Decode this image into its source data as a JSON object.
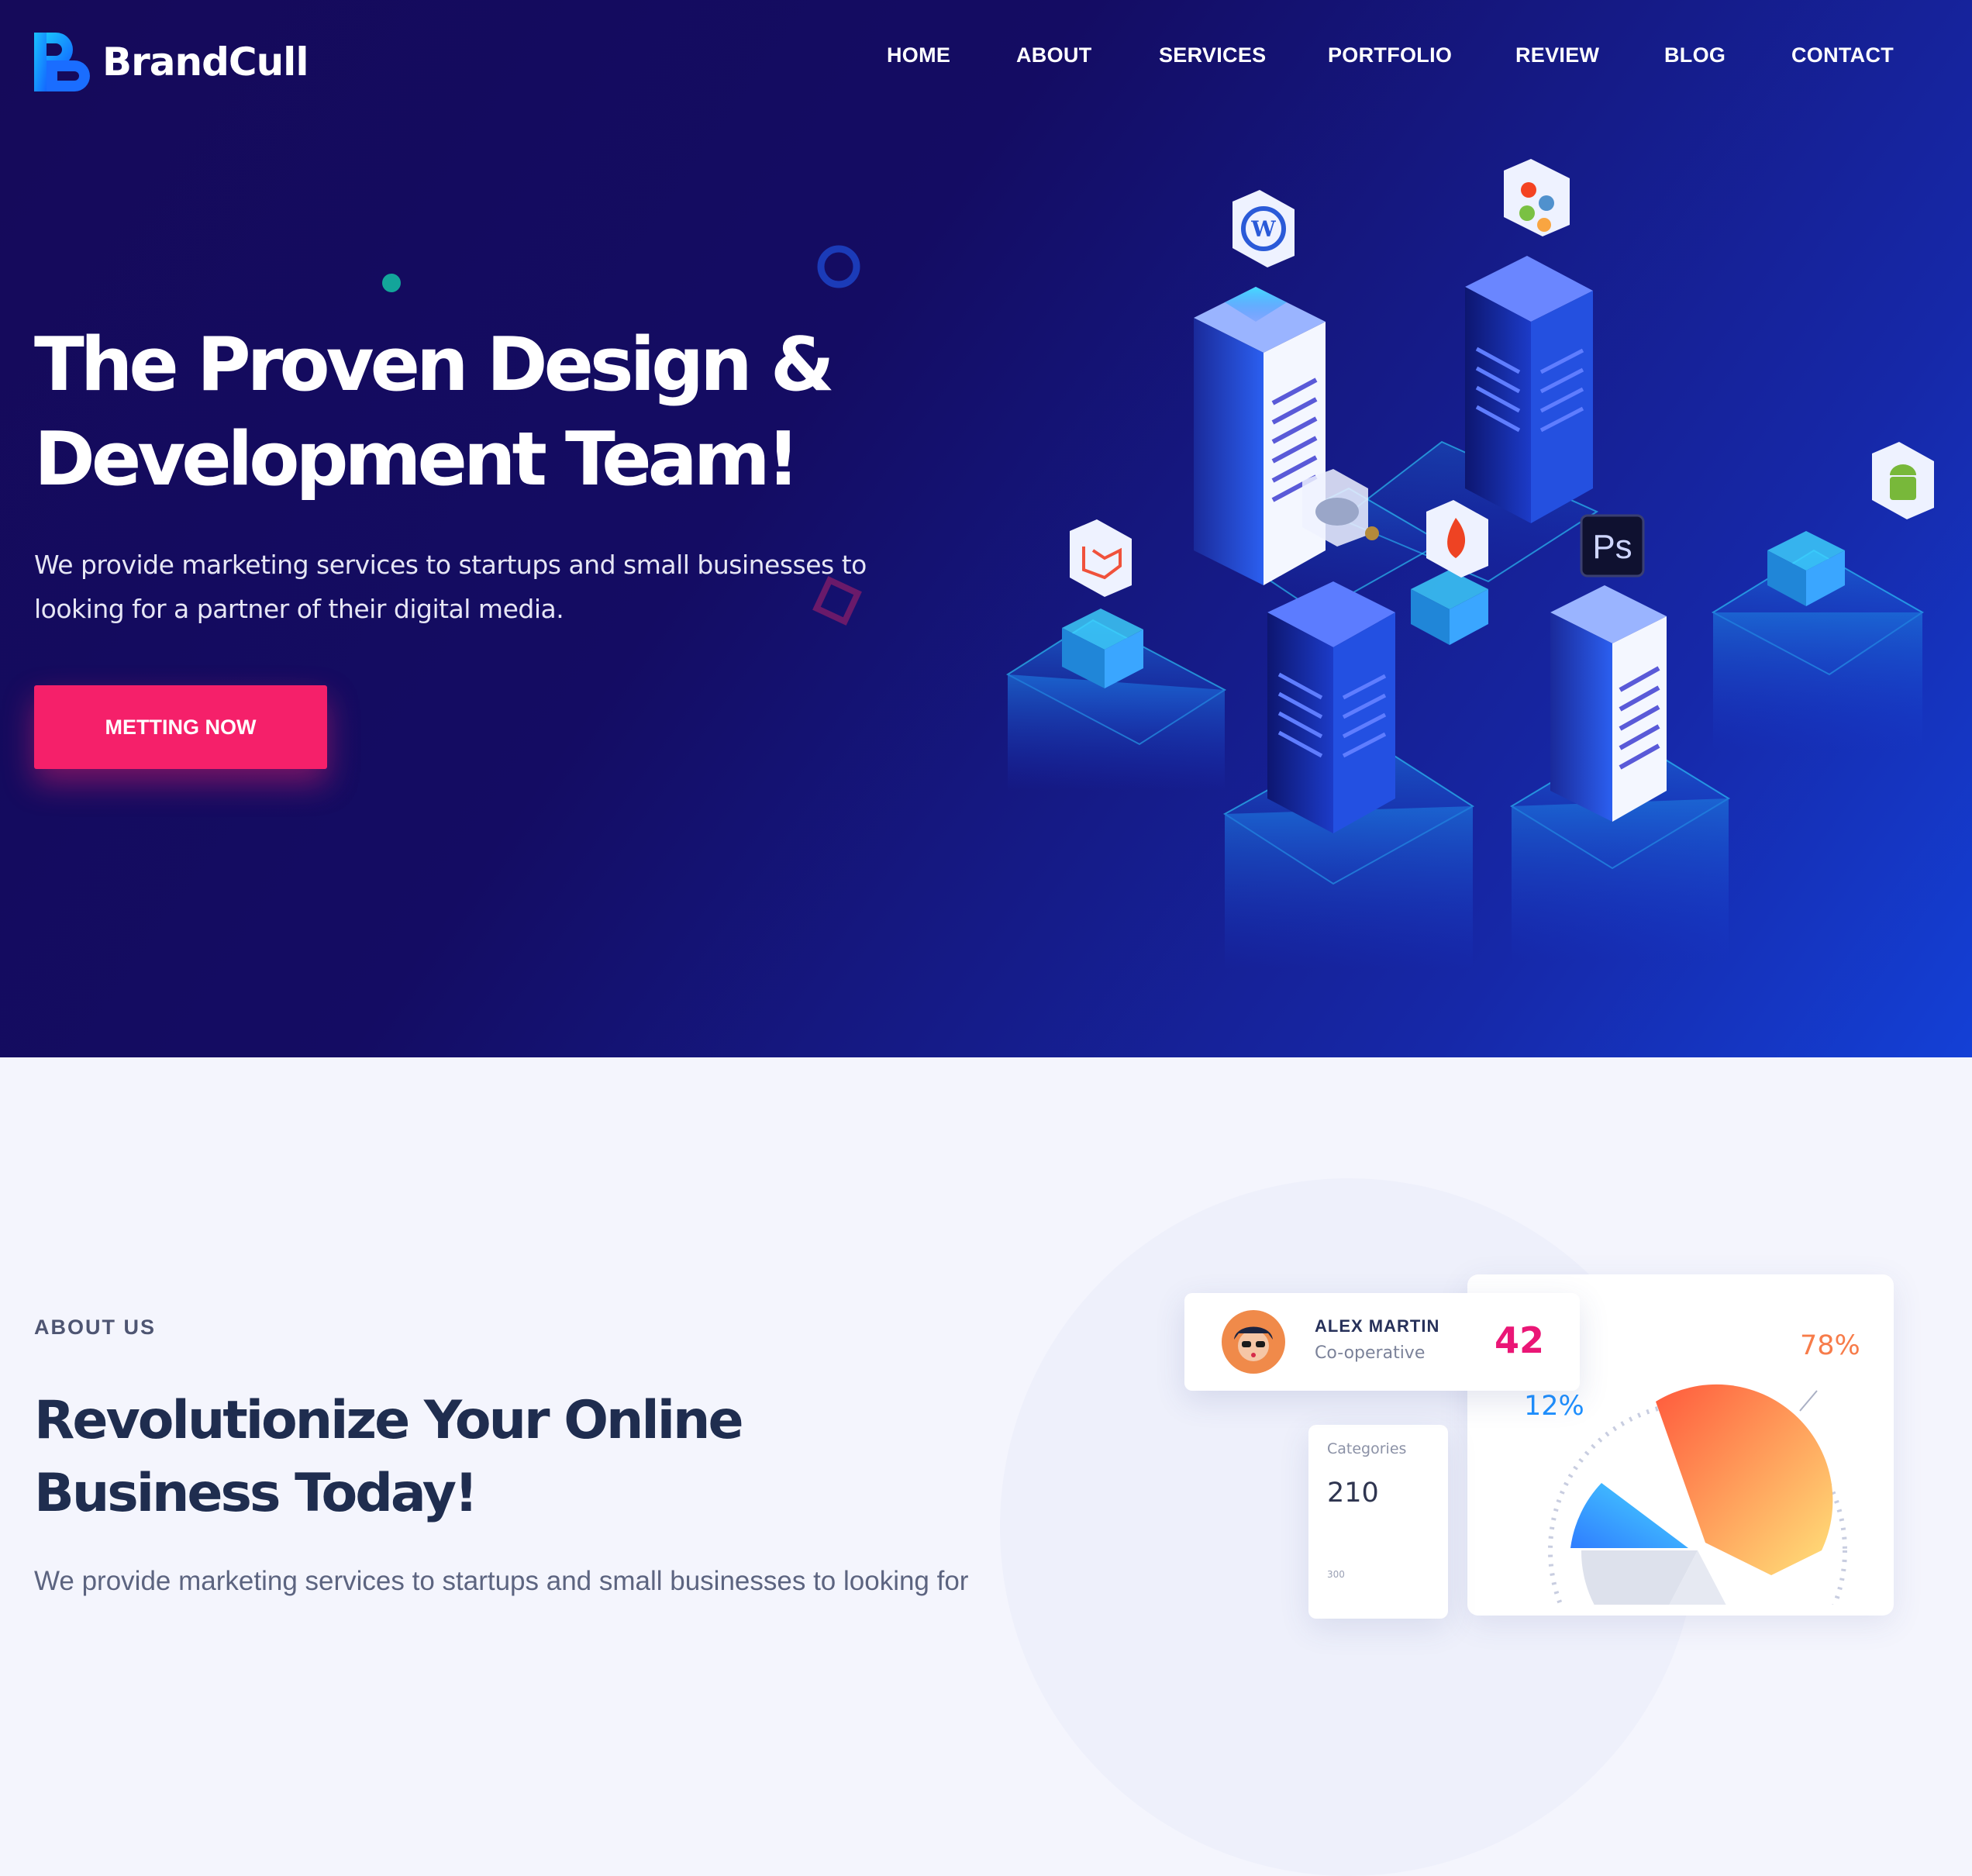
{
  "brand": {
    "name": "BrandCull"
  },
  "nav": {
    "items": [
      {
        "label": "HOME"
      },
      {
        "label": "ABOUT"
      },
      {
        "label": "SERVICES"
      },
      {
        "label": "PORTFOLIO"
      },
      {
        "label": "REVIEW"
      },
      {
        "label": "BLOG"
      },
      {
        "label": "CONTACT"
      }
    ]
  },
  "hero": {
    "title_line1": "The Proven Design &",
    "title_line2": "Development Team!",
    "lead_line1": "We provide marketing services to startups and small businesses to",
    "lead_line2": "looking for a partner of their digital media.",
    "cta_label": "METTING NOW",
    "illustration_icons": [
      "wordpress-icon",
      "joomla-icon",
      "cloud-icon",
      "codeigniter-icon",
      "photoshop-icon",
      "laravel-icon",
      "android-icon"
    ],
    "photoshop_label": "Ps"
  },
  "about": {
    "tag": "ABOUT US",
    "title_line1": "Revolutionize Your Online",
    "title_line2": "Business Today!",
    "text": "We provide marketing services to startups and small businesses to looking for"
  },
  "widget": {
    "profile": {
      "name": "ALEX MARTIN",
      "role": "Co-operative",
      "number": "42"
    },
    "categories": {
      "label": "Categories",
      "value": "210",
      "tick": "300"
    },
    "pie": {
      "label_large": "78%",
      "label_small": "12%"
    }
  },
  "colors": {
    "accent": "#f5206a",
    "hero_bg_start": "#150a5a",
    "hero_bg_end": "#1440d6",
    "heading_dark": "#1f2d4f",
    "stat_pink": "#ea1676",
    "pie_orange": "#ff7a3d",
    "pie_blue": "#1e90ff"
  }
}
